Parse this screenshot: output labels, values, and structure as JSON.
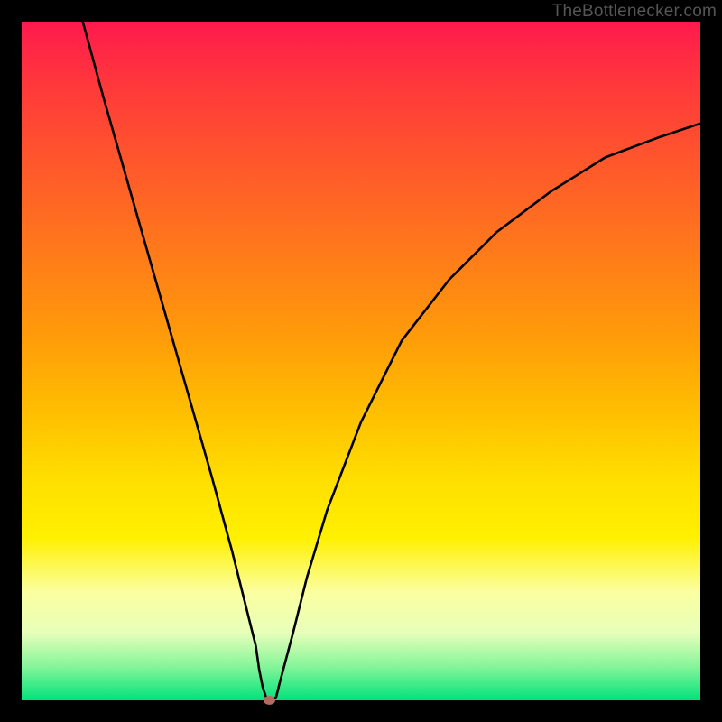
{
  "watermark": "TheBottlenecker.com",
  "chart_data": {
    "type": "line",
    "title": "",
    "xlabel": "",
    "ylabel": "",
    "xlim": [
      0,
      100
    ],
    "ylim": [
      0,
      100
    ],
    "series": [
      {
        "name": "curve",
        "x": [
          9,
          12,
          16,
          20,
          24,
          28,
          31,
          33,
          34.5,
          35,
          35.5,
          36,
          36.5,
          37,
          37.5,
          38,
          40,
          42,
          45,
          50,
          56,
          63,
          70,
          78,
          86,
          94,
          100
        ],
        "values": [
          100,
          89,
          75,
          61,
          47,
          33,
          22,
          14,
          8,
          4.5,
          2,
          0.5,
          0,
          0,
          0.5,
          2.5,
          10,
          18,
          28,
          41,
          53,
          62,
          69,
          75,
          80,
          83,
          85
        ]
      }
    ],
    "marker": {
      "x": 36.5,
      "y": 0,
      "color": "#b46a5f"
    },
    "gradient_bands": [
      {
        "y": 0,
        "color": "#ff1a4d"
      },
      {
        "y": 50,
        "color": "#ffe000"
      },
      {
        "y": 100,
        "color": "#00e27a"
      }
    ]
  }
}
